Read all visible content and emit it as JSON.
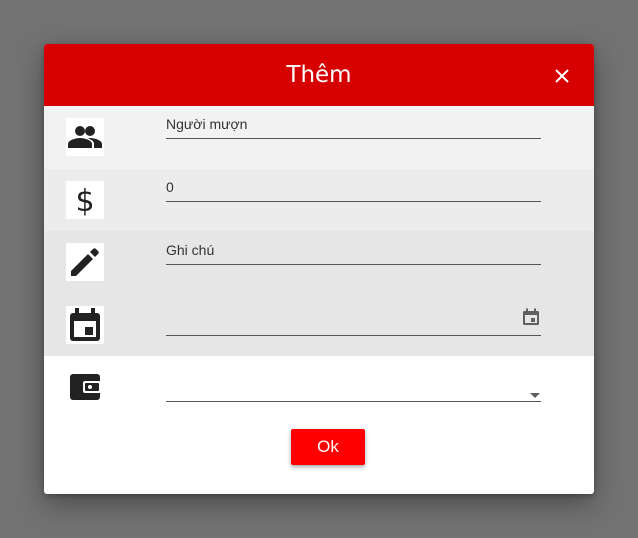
{
  "dialog": {
    "title": "Thêm",
    "close_icon": "close-icon",
    "accent_color": "#d60000",
    "ok_button_color": "#ff0000"
  },
  "form": {
    "borrower": {
      "icon": "people-icon",
      "value": "Người mượn"
    },
    "amount": {
      "icon": "dollar-icon",
      "value": "0"
    },
    "note": {
      "icon": "pencil-icon",
      "value": "Ghi chú"
    },
    "date": {
      "icon": "calendar-icon",
      "value": "",
      "picker_icon": "calendar-small-icon"
    },
    "wallet": {
      "icon": "wallet-icon",
      "value": "",
      "dropdown_icon": "dropdown-arrow-icon"
    }
  },
  "actions": {
    "ok_label": "Ok"
  }
}
